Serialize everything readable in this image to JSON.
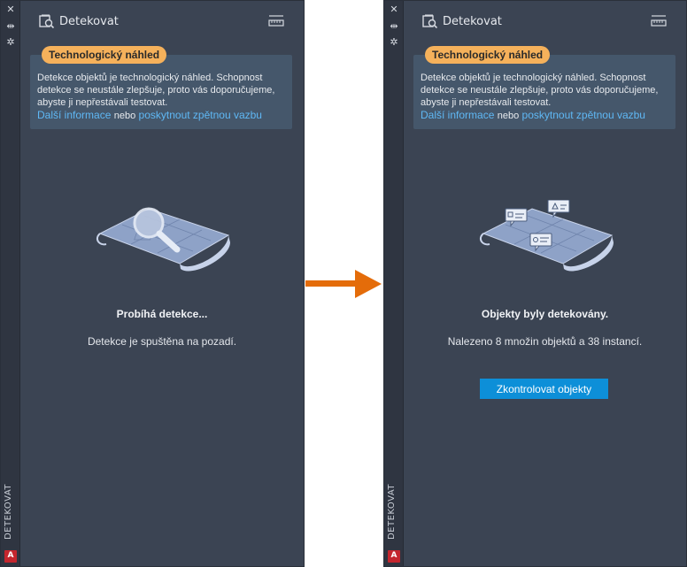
{
  "arrow_color": "#e46c0a",
  "panels": [
    {
      "side_label": "DETEKOVAT",
      "badge": "A",
      "header_title": "Detekovat",
      "tech_badge": "Technologický náhled",
      "tech_text": "Detekce objektů je technologický náhled. Schopnost detekce se neustále zlepšuje, proto vás doporučujeme, abyste ji nepřestávali testovat.",
      "link_more": "Další informace",
      "link_sep": "nebo",
      "link_feedback": "poskytnout zpětnou vazbu",
      "status_title": "Probíhá detekce...",
      "status_sub": "Detekce je spuštěna na pozadí."
    },
    {
      "side_label": "DETEKOVAT",
      "badge": "A",
      "header_title": "Detekovat",
      "tech_badge": "Technologický náhled",
      "tech_text": "Detekce objektů je technologický náhled. Schopnost detekce se neustále zlepšuje, proto vás doporučujeme, abyste ji nepřestávali testovat.",
      "link_more": "Další informace",
      "link_sep": "nebo",
      "link_feedback": "poskytnout zpětnou vazbu",
      "status_title": "Objekty byly detekovány.",
      "status_sub": "Nalezeno 8 množin objektů a 38 instancí.",
      "button_label": "Zkontrolovat objekty"
    }
  ]
}
